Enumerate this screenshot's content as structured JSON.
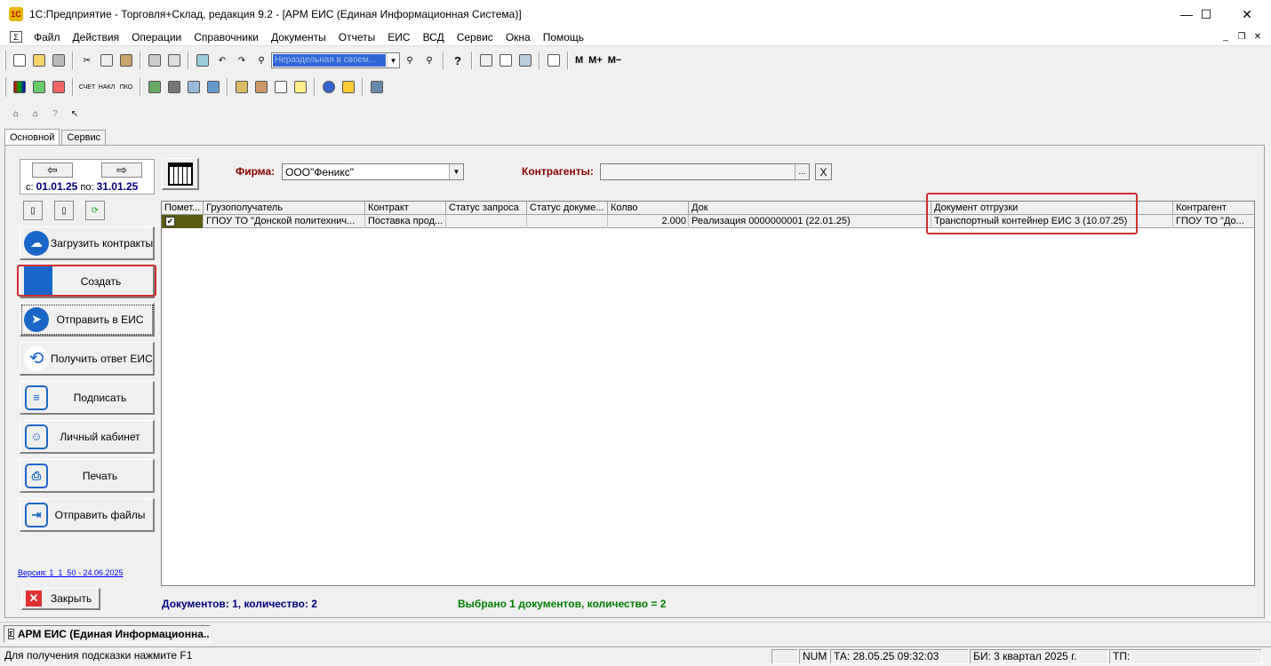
{
  "window": {
    "title": "1С:Предприятие - Торговля+Склад, редакция 9.2 - [АРМ ЕИС (Единая Информационная Система)]"
  },
  "menu": [
    "Файл",
    "Действия",
    "Операции",
    "Справочники",
    "Документы",
    "Отчеты",
    "ЕИС",
    "ВСД",
    "Сервис",
    "Окна",
    "Помощь"
  ],
  "toolbar": {
    "combo_value": "Нераздельная в своем...",
    "m_buttons": [
      "М",
      "М+",
      "М−"
    ],
    "icons": [
      "new-document-icon",
      "open-folder-icon",
      "save-icon",
      "cut-icon",
      "copy-icon",
      "paste-icon",
      "print-icon",
      "print-preview-icon",
      "calculator-icon",
      "undo-icon",
      "redo-icon",
      "binoculars-icon",
      "find-next-icon",
      "help-icon"
    ]
  },
  "tabs": [
    "Основной",
    "Сервис"
  ],
  "sidebar": {
    "date_from_label": "с:",
    "date_from": "01.01.25",
    "date_to_label": "по:",
    "date_to": "31.01.25",
    "buttons": [
      {
        "label": "Загрузить контракты",
        "icon": "cloud-upload-icon"
      },
      {
        "label": "Создать",
        "icon": "create-icon"
      },
      {
        "label": "Отправить в ЕИС",
        "icon": "send-plane-icon"
      },
      {
        "label": "Получить ответ ЕИС",
        "icon": "refresh-icon"
      },
      {
        "label": "Подписать",
        "icon": "document-sign-icon"
      },
      {
        "label": "Личный кабинет",
        "icon": "user-icon"
      },
      {
        "label": "Печать",
        "icon": "printer-icon"
      },
      {
        "label": "Отправить файлы",
        "icon": "file-send-icon"
      }
    ],
    "version": "Версия: 1_1_50 - 24.06.2025",
    "close_label": "Закрыть"
  },
  "filters": {
    "firm_label": "Фирма:",
    "firm_value": "ООО\"Феникс\"",
    "contragents_label": "Контрагенты:",
    "contragents_value": "",
    "ellipsis": "...",
    "clear": "X"
  },
  "grid": {
    "columns": [
      "Помет...",
      "Грузополучатель",
      "Контракт",
      "Статус запроса",
      "Статус докуме...",
      "Колво",
      "Док",
      "Документ отгрузки",
      "Контрагент"
    ],
    "rows": [
      {
        "checked": true,
        "check_mark": "✔",
        "consignee": "ГПОУ  ТО \"Донской политехнич...",
        "contract": "Поставка прод...",
        "request_status": "",
        "doc_status": "",
        "qty": "2.000",
        "doc": "Реализация  0000000001 (22.01.25)",
        "shipment_doc": "Транспортный контейнер ЕИС 3 (10.07.25)",
        "contragent": "ГПОУ  ТО \"До..."
      }
    ]
  },
  "summary": {
    "documents": "Документов: 1, количество: 2",
    "selected": "Выбрано 1 документов, количество = 2"
  },
  "taskbar": {
    "item": "АРМ ЕИС (Единая Информационна..."
  },
  "statusbar": {
    "hint": "Для получения подсказки нажмите F1",
    "num": "NUM",
    "ta": "ТА: 28.05.25  09:32:03",
    "bi": "БИ: 3 квартал 2025 г.",
    "tp": "ТП:"
  },
  "colors": {
    "highlight_box": "#d03030",
    "icon_blue": "#1a66c8",
    "summary_blue": "#000080",
    "summary_green": "#008000",
    "label_red": "#8b0000"
  }
}
